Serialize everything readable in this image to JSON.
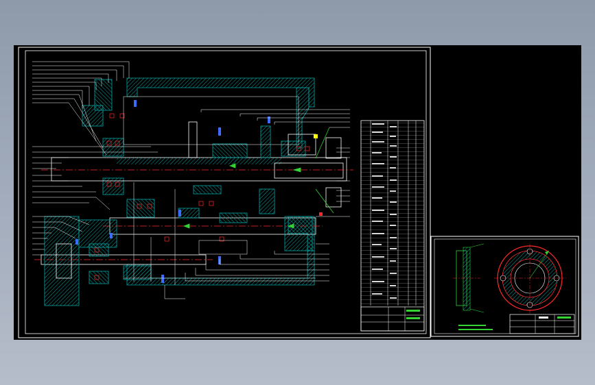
{
  "colors": {
    "background_top": "#8e9aaa",
    "background_bottom": "#b6bdca",
    "sheet": "#000000",
    "frame": "#ffffff",
    "section_hatch": "#00a8a8",
    "centerline": "#ff2a2a",
    "dimension": "#33d433",
    "annotation": "#3b6cff",
    "highlight": "#ffff00",
    "leader": "#ffffff"
  },
  "icons": {
    "main_assembly": "gearbox-section-drawing-icon",
    "part_side_view": "flange-side-view-icon",
    "part_front_view": "flange-front-view-icon",
    "parts_list": "parts-list-table-icon",
    "title_block": "title-block-icon"
  }
}
